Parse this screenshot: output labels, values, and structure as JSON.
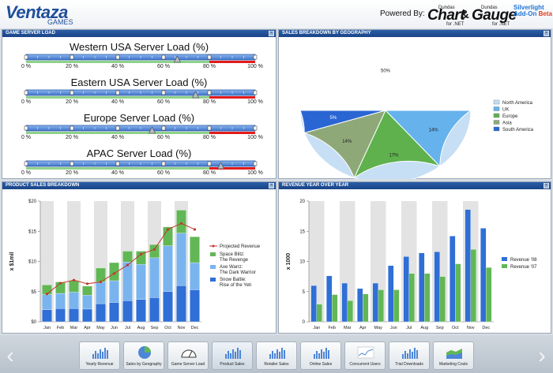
{
  "header": {
    "logo": "Ventaza",
    "logo_sub": "GAMES",
    "powered_by": "Powered By:",
    "brand1_small": "Dundas",
    "brand1": "Chart",
    "brand1_for": "for .NET",
    "amp": "&",
    "brand2_small": "Dundas",
    "brand2": "Gauge",
    "brand2_for": "for .NET",
    "silverlight1": "Silverlight",
    "silverlight2": "Add-On",
    "beta": "Beta"
  },
  "panels": {
    "game_server_load": "GAME SERVER LOAD",
    "sales_by_geo": "SALES BREAKDOWN BY GEOGRAPHY",
    "product_sales": "PRODUCT SALES BREAKDOWN",
    "revenue_yoy": "REVENUE YEAR OVER YEAR"
  },
  "gauges": [
    {
      "title": "Western USA Server Load (%)",
      "value": 66
    },
    {
      "title": "Eastern USA Server Load (%)",
      "value": 74
    },
    {
      "title": "Europe Server Load (%)",
      "value": 55
    },
    {
      "title": "APAC Server Load (%)",
      "value": 85
    }
  ],
  "gauge_ticks": [
    "0 %",
    "20 %",
    "40 %",
    "60 %",
    "80 %",
    "100 %"
  ],
  "pie": {
    "labels": [
      "50%",
      "14%",
      "17%",
      "14%",
      "5%"
    ],
    "legend": [
      "North America",
      "UK",
      "Europe",
      "Asia",
      "South America"
    ],
    "colors": [
      "#c7dff4",
      "#66b2ec",
      "#5fb14e",
      "#8fa878",
      "#2a66d3"
    ],
    "values": [
      50,
      14,
      17,
      14,
      5
    ]
  },
  "chart_data": [
    {
      "type": "bar",
      "ylabel": "x $1mil",
      "categories": [
        "Jan",
        "Feb",
        "Mar",
        "Apr",
        "May",
        "Jun",
        "Jul",
        "Aug",
        "Sep",
        "Oct",
        "Nov",
        "Dec"
      ],
      "yticks": [
        "$0",
        "$5",
        "$10",
        "$15",
        "$20"
      ],
      "ylim": [
        0,
        20
      ],
      "series": [
        {
          "name": "Snow Battle: Rise of the Yeti",
          "values": [
            2.0,
            2.2,
            2.2,
            2.1,
            3.0,
            3.2,
            3.5,
            3.7,
            4.0,
            5.0,
            6.0,
            5.3
          ]
        },
        {
          "name": "Axe Warrz: The Dark Warrior",
          "values": [
            2.5,
            2.5,
            2.7,
            2.3,
            3.6,
            3.6,
            6.4,
            5.8,
            6.6,
            7.6,
            8.7,
            4.5
          ]
        },
        {
          "name": "Space Blitz: The Revenge",
          "values": [
            1.6,
            1.9,
            1.9,
            1.5,
            2.3,
            3.0,
            1.8,
            2.2,
            2.2,
            3.1,
            3.8,
            4.3
          ]
        }
      ],
      "line": {
        "name": "Projected Revenue",
        "values": [
          4.6,
          6.4,
          6.9,
          6.3,
          6.6,
          8.0,
          9.4,
          11.2,
          12.0,
          15.3,
          16.3,
          15.3
        ]
      }
    },
    {
      "type": "bar",
      "ylabel": "x 1000",
      "categories": [
        "Jan",
        "Feb",
        "Mar",
        "Apr",
        "May",
        "Jun",
        "Jul",
        "Aug",
        "Sep",
        "Oct",
        "Nov",
        "Dec"
      ],
      "yticks": [
        "0",
        "5",
        "10",
        "15",
        "20"
      ],
      "ylim": [
        0,
        20
      ],
      "series": [
        {
          "name": "Revenue '08",
          "values": [
            6.0,
            7.6,
            6.4,
            5.5,
            6.4,
            9.3,
            10.8,
            11.4,
            11.6,
            14.2,
            18.6,
            15.5
          ]
        },
        {
          "name": "Revenue '07",
          "values": [
            2.9,
            4.5,
            3.5,
            4.6,
            5.3,
            5.3,
            8.0,
            8.0,
            7.5,
            9.6,
            12.0,
            9.0
          ]
        }
      ]
    }
  ],
  "legend1": [
    "Projected Revenue",
    "Space Blitz:",
    "The Revenge",
    "Axe Warrz:",
    "The Dark Warrior",
    "Snow Battle:",
    "Rise of the Yeti"
  ],
  "legend2": [
    "Revenue '08",
    "Revenue '07"
  ],
  "nav": [
    {
      "label": "Yearly Revenue",
      "icon": "bar-chart-icon"
    },
    {
      "label": "Sales by Geography",
      "icon": "pie-chart-icon"
    },
    {
      "label": "Game Server Load",
      "icon": "gauge-icon"
    },
    {
      "label": "Product Sales",
      "icon": "bar-chart-icon"
    },
    {
      "label": "Retailer Sales",
      "icon": "bar-chart-icon"
    },
    {
      "label": "Online Sales",
      "icon": "bar-chart-icon"
    },
    {
      "label": "Concurrent Users",
      "icon": "line-chart-icon"
    },
    {
      "label": "Trial Downloads",
      "icon": "bar-chart-icon"
    },
    {
      "label": "Marketing Costs",
      "icon": "area-chart-icon"
    }
  ]
}
